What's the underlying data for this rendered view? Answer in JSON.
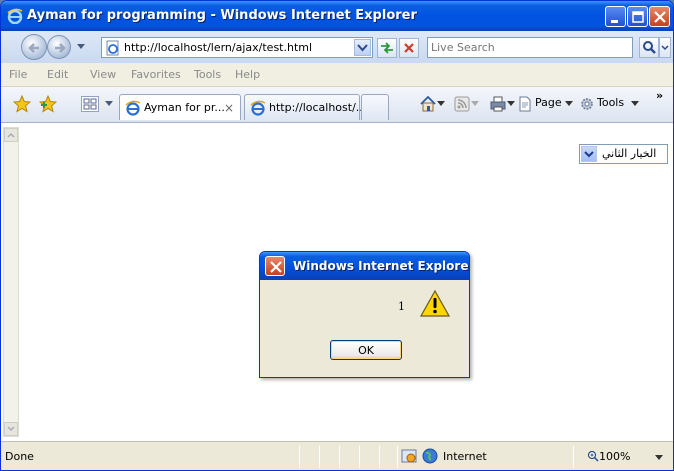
{
  "window": {
    "title": "Ayman for programming - Windows Internet Explorer"
  },
  "address": {
    "url": "http://localhost/lern/ajax/test.html",
    "search_placeholder": "Live Search"
  },
  "menu": {
    "items": [
      "File",
      "Edit",
      "View",
      "Favorites",
      "Tools",
      "Help"
    ]
  },
  "tabs": [
    {
      "label": "Ayman for pr...",
      "close": "×"
    },
    {
      "label": "http://localhost/..."
    }
  ],
  "toolbar": {
    "page_label": "Page",
    "tools_label": "Tools",
    "overflow": "»"
  },
  "page": {
    "select_value": "الخيار الثاني"
  },
  "dialog": {
    "title": "Windows Internet Explorer",
    "message": "1",
    "ok_label": "OK"
  },
  "status": {
    "text": "Done",
    "zone": "Internet",
    "zoom": "100%"
  },
  "colors": {
    "titlebar": "#0053e1",
    "frame": "#ece9d8"
  },
  "icons": [
    "ie-logo-icon",
    "back-arrow-icon",
    "forward-arrow-icon",
    "refresh-icon",
    "stop-icon",
    "search-icon",
    "favorites-star-icon",
    "add-favorites-icon",
    "quick-tabs-icon",
    "home-icon",
    "feeds-icon",
    "print-icon",
    "page-icon",
    "gear-icon",
    "warning-icon",
    "close-icon",
    "globe-icon",
    "zoom-icon"
  ]
}
